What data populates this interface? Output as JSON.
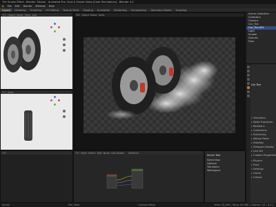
{
  "window": {
    "title": "Tire Smoke Effect - Blender Tutorial - Animated Fire, Dust & Smoke Video [Code Simulations] - Blender 4.0"
  },
  "menu": [
    "File",
    "Edit",
    "Render",
    "Window",
    "Help"
  ],
  "workspaces": [
    "Layout",
    "Modeling",
    "Sculpting",
    "UV Editing",
    "Texture Paint",
    "Shading",
    "Animation",
    "Rendering",
    "Compositing",
    "Geometry Nodes",
    "Scripting"
  ],
  "viewport_header": {
    "mode": "Object Mode",
    "view": "View",
    "add": "Add",
    "shading": "Solid"
  },
  "outliner": {
    "rows": [
      "Scene Collection",
      "Collection",
      "Camera",
      "Car_Tire",
      "Car_Tire.001",
      "Light",
      "Smoke",
      "Domain",
      "Flow"
    ],
    "selected_index": 4
  },
  "properties": {
    "object_name": "Car Tire",
    "rows": [
      "Transform",
      "Delta Transform",
      "Relations",
      "Collections",
      "Instancing",
      "Motion Paths",
      "Visibility",
      "Viewport Display",
      "Line Art",
      "Custom Properties",
      "Physics",
      "Fluid",
      "Settings",
      "Cache",
      "Output"
    ]
  },
  "node_editor": {
    "header": [
      "View",
      "Select",
      "Add",
      "Node",
      "Use Nodes"
    ],
    "material": "Material"
  },
  "side_panel": {
    "title": "Active Tool",
    "items": [
      "Select Box",
      "Options",
      "Transform",
      "Workspace"
    ]
  },
  "status": {
    "left": "Select",
    "middle": "Pan View",
    "right": "Context Menu",
    "version": "Verts 45,280 | Faces 44,960 | Objects 1/5 | 4.0.2"
  },
  "colors": {
    "accent": "#334d80",
    "rim": "#8a8a8a",
    "caliper": "#c0392b"
  }
}
